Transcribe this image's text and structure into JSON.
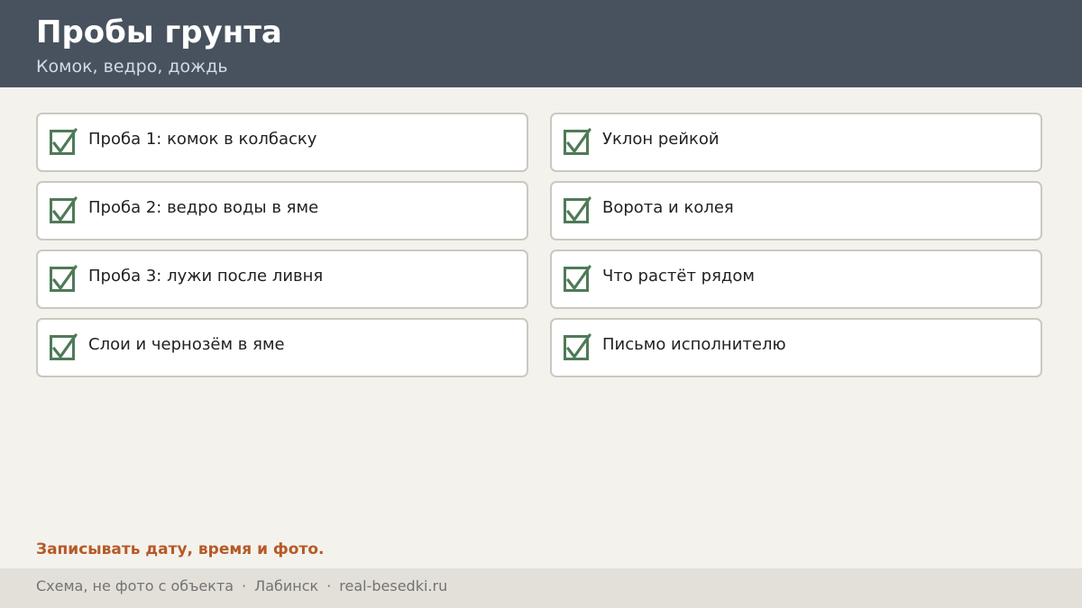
{
  "header": {
    "title": "Пробы грунта",
    "subtitle": "Комок, ведро, дождь"
  },
  "checklist": {
    "left": [
      {
        "label": "Проба 1: комок в колбаску",
        "checked": true
      },
      {
        "label": "Проба 2: ведро воды в яме",
        "checked": true
      },
      {
        "label": "Проба 3: лужи после ливня",
        "checked": true
      },
      {
        "label": "Слои и чернозём в яме",
        "checked": true
      }
    ],
    "right": [
      {
        "label": "Уклон рейкой",
        "checked": true
      },
      {
        "label": "Ворота и колея",
        "checked": true
      },
      {
        "label": "Что растёт рядом",
        "checked": true
      },
      {
        "label": "Письмо исполнителю",
        "checked": true
      }
    ]
  },
  "note": "Записывать дату, время и фото.",
  "footer": {
    "disclaimer": "Схема, не фото с объекта",
    "separator": "·",
    "city": "Лабинск",
    "site": "real-besedki.ru"
  },
  "colors": {
    "header_bg": "#48525e",
    "check_green": "#4f7a58",
    "note_orange": "#b55a27",
    "page_bg": "#f4f2ed"
  },
  "icons": {
    "check": "check-icon"
  }
}
